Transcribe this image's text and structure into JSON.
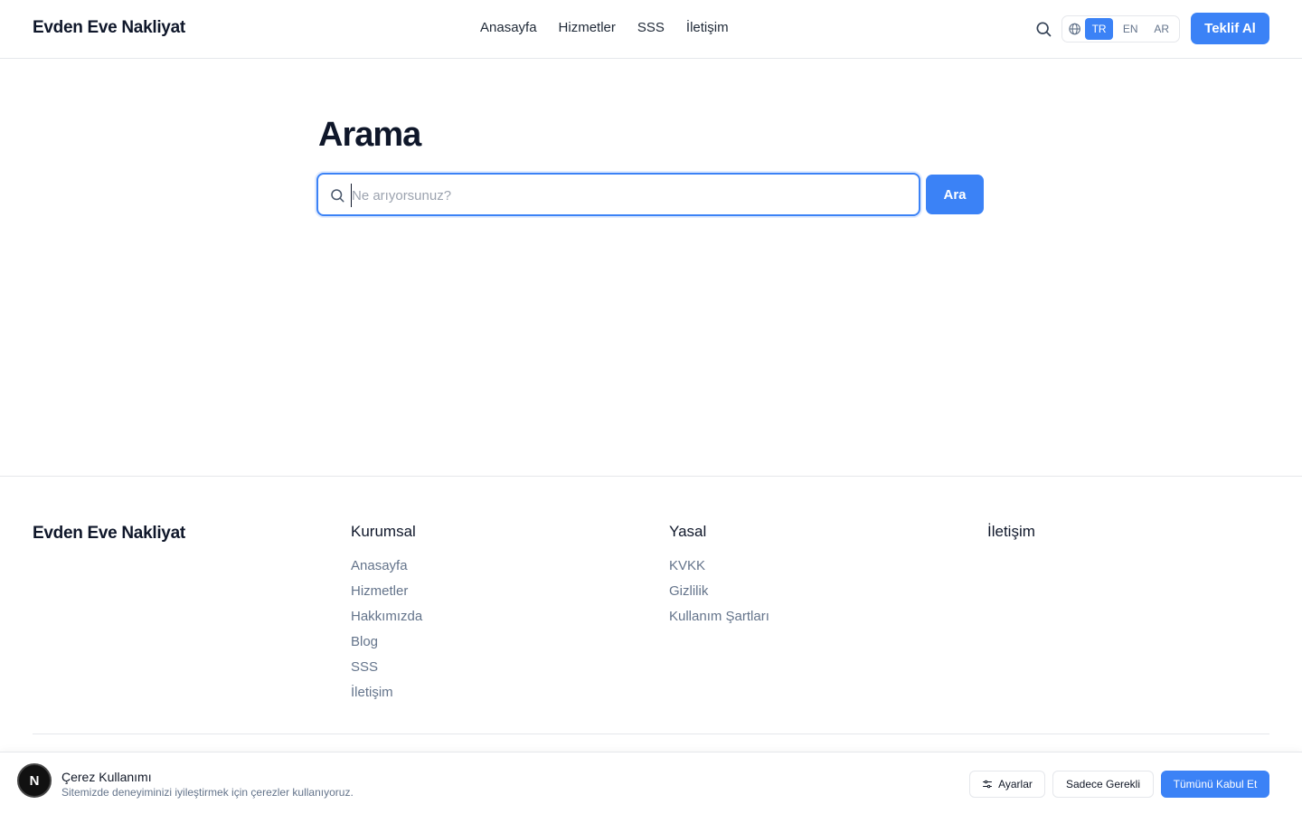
{
  "header": {
    "brand": "Evden Eve Nakliyat",
    "nav": [
      "Anasayfa",
      "Hizmetler",
      "SSS",
      "İletişim"
    ],
    "languages": [
      "TR",
      "EN",
      "AR"
    ],
    "active_language": "TR",
    "cta_label": "Teklif Al"
  },
  "main": {
    "title": "Arama",
    "search_placeholder": "Ne arıyorsunuz?",
    "search_value": "",
    "search_button": "Ara"
  },
  "footer": {
    "brand": "Evden Eve Nakliyat",
    "columns": [
      {
        "title": "Kurumsal",
        "links": [
          "Anasayfa",
          "Hizmetler",
          "Hakkımızda",
          "Blog",
          "SSS",
          "İletişim"
        ]
      },
      {
        "title": "Yasal",
        "links": [
          "KVKK",
          "Gizlilik",
          "Kullanım Şartları"
        ]
      },
      {
        "title": "İletişim",
        "links": []
      }
    ]
  },
  "cookie": {
    "avatar_letter": "N",
    "title": "Çerez Kullanımı",
    "description": "Sitemizde deneyiminizi iyileştirmek için çerezler kullanıyoruz.",
    "settings_label": "Ayarlar",
    "necessary_label": "Sadece Gerekli",
    "accept_all_label": "Tümünü Kabul Et"
  },
  "colors": {
    "accent": "#3b82f6",
    "text": "#0f172a",
    "muted": "#64748b",
    "border": "#e5e7eb"
  },
  "icons": {
    "header_search": "search-icon",
    "language": "globe-icon",
    "input_search": "search-icon",
    "cookie_settings": "sliders-icon"
  }
}
